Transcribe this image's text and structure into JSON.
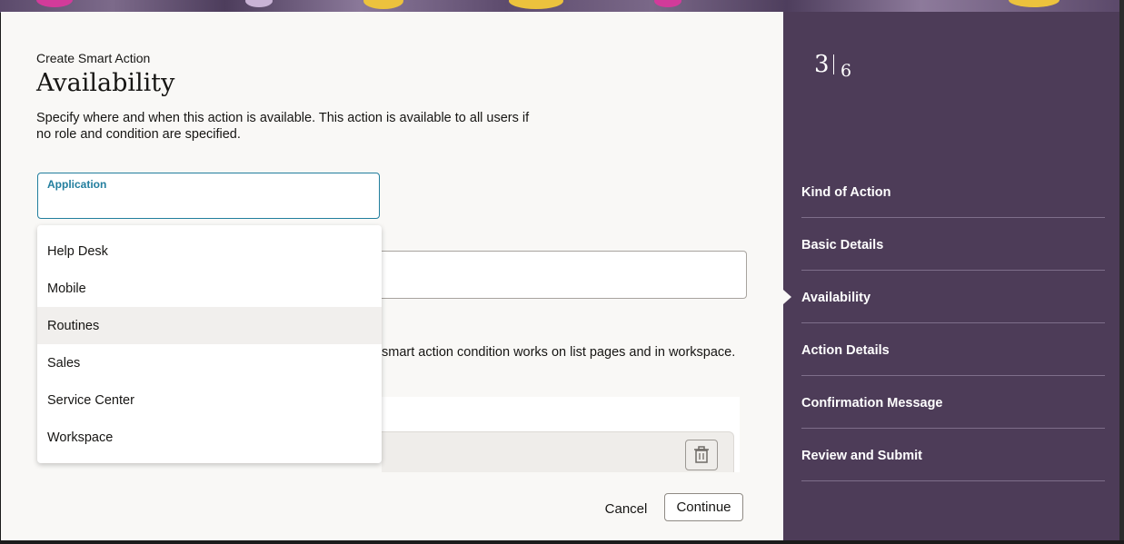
{
  "form": {
    "eyebrow": "Create Smart Action",
    "title": "Availability",
    "description": "Specify where and when this action is available. This action is available to all users if no role and condition are specified.",
    "application_label": "Application",
    "application_value": "",
    "condition_text_fragment": "smart action condition works on list pages and in workspace."
  },
  "dropdown": {
    "options": [
      "Help Desk",
      "Mobile",
      "Routines",
      "Sales",
      "Service Center",
      "Workspace"
    ],
    "highlighted": "Routines"
  },
  "buttons": {
    "cancel": "Cancel",
    "continue": "Continue"
  },
  "progress": {
    "current": "3",
    "total": "6"
  },
  "steps": [
    "Kind of Action",
    "Basic Details",
    "Availability",
    "Action Details",
    "Confirmation Message",
    "Review and Submit"
  ],
  "active_step": "Availability",
  "icons": {
    "delete": "trash-icon"
  },
  "colors": {
    "accent": "#227e9e",
    "sidebar": "#4d3c58"
  }
}
